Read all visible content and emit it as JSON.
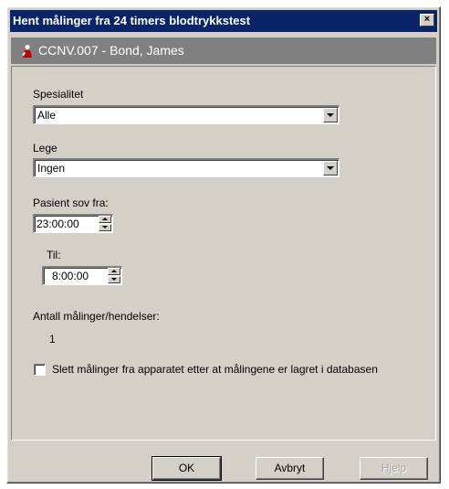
{
  "window": {
    "title": "Hent målinger fra 24 timers blodtrykkstest",
    "close_label": "×"
  },
  "patient": {
    "label": "CCNV.007 - Bond, James",
    "icon": "patient-person-icon"
  },
  "fields": {
    "spesialitet_label": "Spesialitet",
    "spesialitet_value": "Alle",
    "lege_label": "Lege",
    "lege_value": "Ingen",
    "sov_fra_label": "Pasient sov fra:",
    "sov_fra_value": "23:00:00",
    "til_label": "Til:",
    "til_value": "8:00:00",
    "antall_label": "Antall målinger/hendelser:",
    "antall_value": "1",
    "slett_label": "Slett målinger fra apparatet etter at målingene er lagret i databasen",
    "slett_checked": false
  },
  "buttons": {
    "ok_label": "OK",
    "avbryt_label": "Avbryt",
    "hjelp_label": "Hjelp"
  },
  "colors": {
    "titlebar": "#0a246a",
    "patient_header": "#808080",
    "dialog_face": "#d4d0c8"
  }
}
